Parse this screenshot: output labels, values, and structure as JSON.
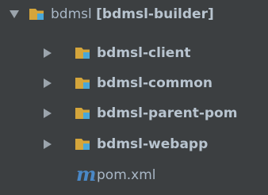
{
  "project_tree": {
    "root": {
      "name": "bdmsl",
      "module_label": "[bdmsl-builder]",
      "expanded": true,
      "icon": "module-folder-icon"
    },
    "children": [
      {
        "label": "bdmsl-client",
        "expanded": false,
        "icon": "module-folder-icon"
      },
      {
        "label": "bdmsl-common",
        "expanded": false,
        "icon": "module-folder-icon"
      },
      {
        "label": "bdmsl-parent-pom",
        "expanded": false,
        "icon": "module-folder-icon"
      },
      {
        "label": "bdmsl-webapp",
        "expanded": false,
        "icon": "module-folder-icon"
      }
    ],
    "file": {
      "label": "pom.xml",
      "icon_glyph": "m",
      "icon": "maven-file-icon"
    },
    "colors": {
      "background": "#3c3f41",
      "text": "#a9b7c6",
      "folder": "#d4a53b",
      "module_marker": "#4aa8d8",
      "maven": "#4a88c7",
      "arrow": "#9ba4ac"
    }
  }
}
